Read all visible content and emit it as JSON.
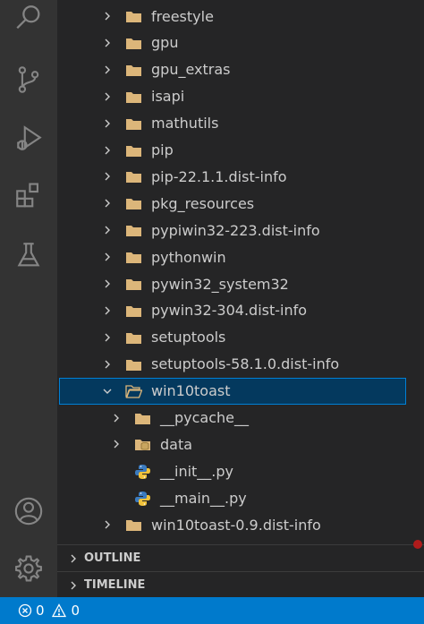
{
  "colors": {
    "folder": "#dcb67a",
    "accent": "#007acc",
    "python": "#3b7bbf"
  },
  "explorer": {
    "items": [
      {
        "label": "freestyle",
        "icon": "folder-icon",
        "state": "collapsed"
      },
      {
        "label": "gpu",
        "icon": "folder-icon",
        "state": "collapsed"
      },
      {
        "label": "gpu_extras",
        "icon": "folder-icon",
        "state": "collapsed"
      },
      {
        "label": "isapi",
        "icon": "folder-icon",
        "state": "collapsed"
      },
      {
        "label": "mathutils",
        "icon": "folder-icon",
        "state": "collapsed"
      },
      {
        "label": "pip",
        "icon": "folder-icon",
        "state": "collapsed"
      },
      {
        "label": "pip-22.1.1.dist-info",
        "icon": "folder-icon",
        "state": "collapsed"
      },
      {
        "label": "pkg_resources",
        "icon": "folder-icon",
        "state": "collapsed"
      },
      {
        "label": "pypiwin32-223.dist-info",
        "icon": "folder-icon",
        "state": "collapsed"
      },
      {
        "label": "pythonwin",
        "icon": "folder-icon",
        "state": "collapsed"
      },
      {
        "label": "pywin32_system32",
        "icon": "folder-icon",
        "state": "collapsed"
      },
      {
        "label": "pywin32-304.dist-info",
        "icon": "folder-icon",
        "state": "collapsed"
      },
      {
        "label": "setuptools",
        "icon": "folder-icon",
        "state": "collapsed"
      },
      {
        "label": "setuptools-58.1.0.dist-info",
        "icon": "folder-icon",
        "state": "collapsed"
      },
      {
        "label": "win10toast",
        "icon": "open-folder-icon",
        "state": "expanded",
        "selected": true
      },
      {
        "label": "__pycache__",
        "icon": "folder-icon",
        "state": "collapsed",
        "nested": true
      },
      {
        "label": "data",
        "icon": "database-folder-icon",
        "state": "collapsed",
        "nested": true
      },
      {
        "label": "__init__.py",
        "icon": "python-file-icon",
        "state": "file",
        "nested": true
      },
      {
        "label": "__main__.py",
        "icon": "python-file-icon",
        "state": "file",
        "nested": true
      },
      {
        "label": "win10toast-0.9.dist-info",
        "icon": "folder-icon",
        "state": "collapsed"
      }
    ]
  },
  "sections": {
    "outline": "OUTLINE",
    "timeline": "TIMELINE"
  },
  "status": {
    "errors": "0",
    "warnings": "0"
  }
}
